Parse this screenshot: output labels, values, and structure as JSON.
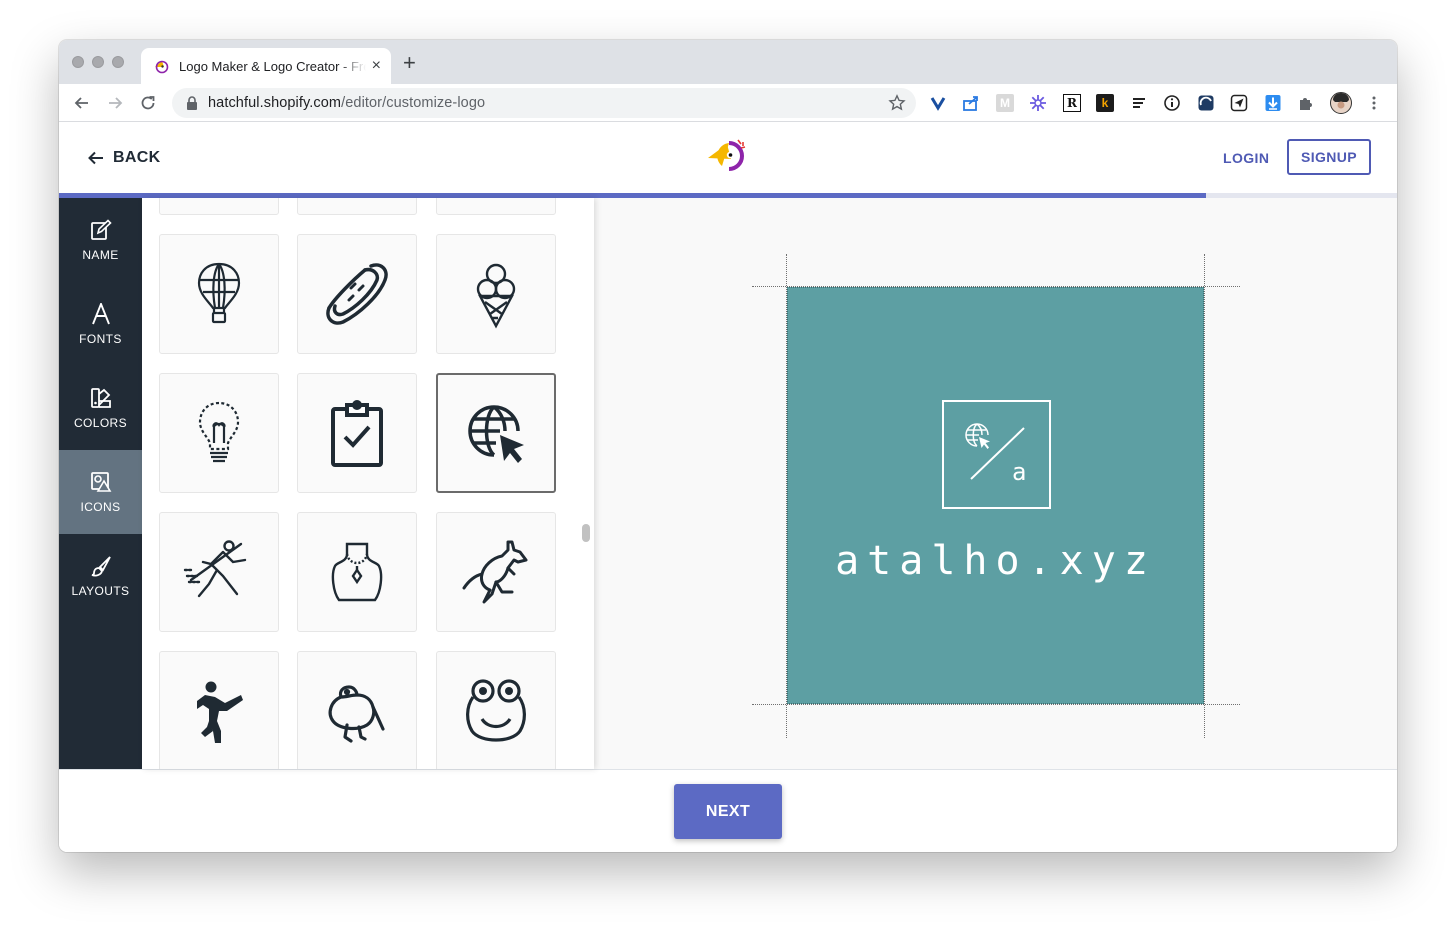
{
  "browser": {
    "tab_title": "Logo Maker & Logo Creator - Free Logo Maker",
    "tab_close": "×",
    "new_tab": "+",
    "url_host": "hatchful.shopify.com",
    "url_path": "/editor/customize-logo",
    "extensions": [
      "pocket-icon",
      "share-icon",
      "m-icon",
      "asterisk-icon",
      "r-icon",
      "k-icon",
      "lines-icon",
      "info-icon",
      "shield-icon",
      "send-icon",
      "download-icon",
      "puzzle-icon",
      "avatar",
      "menu-icon"
    ],
    "ext_letters": {
      "m": "M",
      "r": "R",
      "k": "k"
    }
  },
  "header": {
    "back_label": "BACK",
    "login_label": "LOGIN",
    "signup_label": "SIGNUP",
    "progress": 0.857
  },
  "sidebar": {
    "items": [
      {
        "label": "NAME",
        "icon": "edit-icon",
        "active": false
      },
      {
        "label": "FONTS",
        "icon": "font-icon",
        "active": false
      },
      {
        "label": "COLORS",
        "icon": "palette-icon",
        "active": false
      },
      {
        "label": "ICONS",
        "icon": "shapes-icon",
        "active": true
      },
      {
        "label": "LAYOUTS",
        "icon": "brush-icon",
        "active": false
      }
    ]
  },
  "icon_grid": {
    "rows": [
      [
        "hot-air-balloon-icon",
        "hot-dog-icon",
        "ice-cream-cone-icon"
      ],
      [
        "light-bulb-icon",
        "clipboard-check-icon",
        "globe-cursor-icon"
      ],
      [
        "javelin-thrower-icon",
        "necklace-bust-icon",
        "kangaroo-icon"
      ],
      [
        "karate-kick-icon",
        "kiwi-bird-icon",
        "frog-face-icon"
      ]
    ],
    "selected": "globe-cursor-icon"
  },
  "preview": {
    "logo_text": "atalho.xyz",
    "mark_letter": "a",
    "mark_icon": "globe-cursor-icon",
    "background_color": "#5d9fa3",
    "text_color": "#ffffff"
  },
  "footer": {
    "next_label": "NEXT"
  },
  "colors": {
    "accent": "#5c6ac4",
    "sidebar_bg": "#212b36",
    "sidebar_active": "#637381"
  }
}
